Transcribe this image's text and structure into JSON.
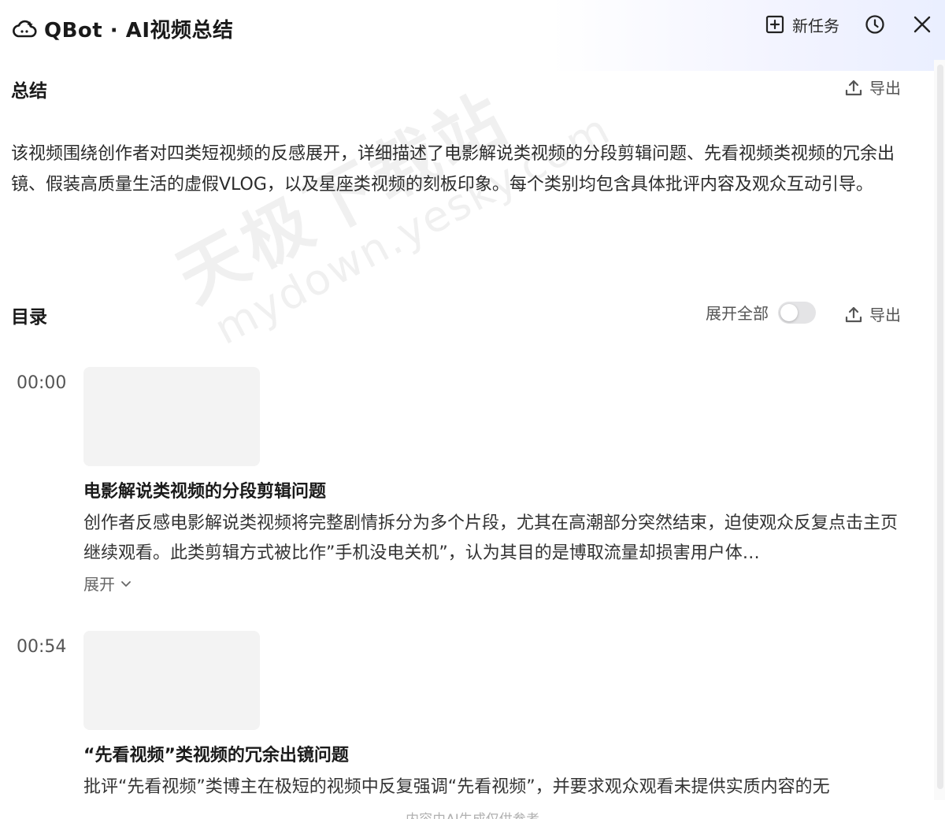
{
  "header": {
    "app_title": "QBot · AI视频总结",
    "new_task_label": "新任务"
  },
  "summary": {
    "title": "总结",
    "export_label": "导出",
    "text": "该视频围绕创作者对四类短视频的反感展开，详细描述了电影解说类视频的分段剪辑问题、先看视频类视频的冗余出镜、假装高质量生活的虚假VLOG，以及星座类视频的刻板印象。每个类别均包含具体批评内容及观众互动引导。"
  },
  "toc": {
    "title": "目录",
    "expand_all_label": "展开全部",
    "expand_all_on": false,
    "export_label": "导出",
    "items": [
      {
        "time": "00:00",
        "title": "电影解说类视频的分段剪辑问题",
        "desc": "创作者反感电影解说类视频将完整剧情拆分为多个片段，尤其在高潮部分突然结束，迫使观众反复点击主页继续观看。此类剪辑方式被比作”手机没电关机”，认为其目的是博取流量却损害用户体…",
        "expand_label": "展开"
      },
      {
        "time": "00:54",
        "title": "“先看视频”类视频的冗余出镜问题",
        "desc": "批评“先看视频”类博主在极短的视频中反复强调“先看视频”，并要求观众观看未提供实质内容的无"
      }
    ]
  },
  "footer_note": "内容由AI生成仅供参考",
  "watermark": {
    "cn": "天极下载站",
    "en": "mydown.yesky.com"
  },
  "colors": {
    "text_primary": "#1a1a1a",
    "text_secondary": "#555555",
    "thumb_bg": "#f3f3f3",
    "toggle_off": "#e4e4e6"
  }
}
